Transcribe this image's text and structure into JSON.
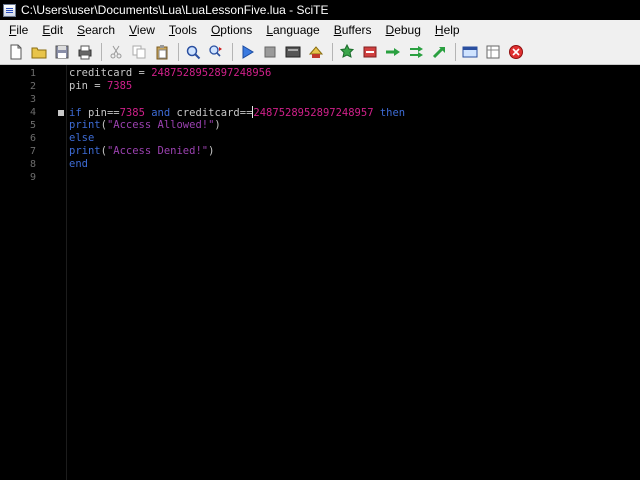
{
  "window": {
    "title": "C:\\Users\\user\\Documents\\Lua\\LuaLessonFive.lua - SciTE"
  },
  "menu": [
    {
      "label": "File",
      "accel": "F",
      "rest": "ile"
    },
    {
      "label": "Edit",
      "accel": "E",
      "rest": "dit"
    },
    {
      "label": "Search",
      "accel": "S",
      "rest": "earch"
    },
    {
      "label": "View",
      "accel": "V",
      "rest": "iew"
    },
    {
      "label": "Tools",
      "accel": "T",
      "rest": "ools"
    },
    {
      "label": "Options",
      "accel": "O",
      "rest": "ptions"
    },
    {
      "label": "Language",
      "accel": "L",
      "rest": "anguage"
    },
    {
      "label": "Buffers",
      "accel": "B",
      "rest": "uffers"
    },
    {
      "label": "Debug",
      "accel": "D",
      "rest": "ebug"
    },
    {
      "label": "Help",
      "accel": "H",
      "rest": "elp"
    }
  ],
  "toolbar": [
    "new-file-icon",
    "open-folder-icon",
    "save-icon",
    "print-icon",
    "cut-icon",
    "copy-icon",
    "paste-icon",
    "find-icon",
    "replace-icon",
    "run-icon",
    "stop-icon",
    "compile-icon",
    "build-icon",
    "bookmark-icon",
    "toggle-icon",
    "go-arrow-icon",
    "next-arrow-icon",
    "jump-icon",
    "window-icon",
    "panel-icon",
    "close-red-icon"
  ],
  "colors": {
    "number": "#d0208a",
    "keyword": "#3d6bd4",
    "string": "#9b41b0",
    "identifier": "#c6c6c6",
    "line_number": "#6d6d6d"
  },
  "editor": {
    "line_numbers": [
      "1",
      "2",
      "3",
      "4",
      "5",
      "6",
      "7",
      "8",
      "9"
    ],
    "lines": [
      [
        {
          "t": "ident",
          "v": "creditcard"
        },
        {
          "t": "op",
          "v": " = "
        },
        {
          "t": "num",
          "v": "2487528952897248956"
        }
      ],
      [
        {
          "t": "ident",
          "v": "pin"
        },
        {
          "t": "op",
          "v": " = "
        },
        {
          "t": "num",
          "v": "7385"
        }
      ],
      [],
      [
        {
          "t": "kw",
          "v": "if"
        },
        {
          "t": "op",
          "v": " "
        },
        {
          "t": "ident",
          "v": "pin"
        },
        {
          "t": "op",
          "v": "=="
        },
        {
          "t": "num",
          "v": "7385"
        },
        {
          "t": "op",
          "v": " "
        },
        {
          "t": "kw",
          "v": "and"
        },
        {
          "t": "op",
          "v": " "
        },
        {
          "t": "ident",
          "v": "creditcard"
        },
        {
          "t": "op",
          "v": "=="
        },
        {
          "t": "caret",
          "v": ""
        },
        {
          "t": "num",
          "v": "2487528952897248957"
        },
        {
          "t": "op",
          "v": " "
        },
        {
          "t": "kw",
          "v": "then"
        }
      ],
      [
        {
          "t": "fn",
          "v": "print"
        },
        {
          "t": "op",
          "v": "("
        },
        {
          "t": "str",
          "v": "\"Access Allowed!\""
        },
        {
          "t": "op",
          "v": ")"
        }
      ],
      [
        {
          "t": "kw",
          "v": "else"
        }
      ],
      [
        {
          "t": "fn",
          "v": "print"
        },
        {
          "t": "op",
          "v": "("
        },
        {
          "t": "str",
          "v": "\"Access Denied!\""
        },
        {
          "t": "op",
          "v": ")"
        }
      ],
      [
        {
          "t": "kw",
          "v": "end"
        }
      ],
      []
    ]
  }
}
